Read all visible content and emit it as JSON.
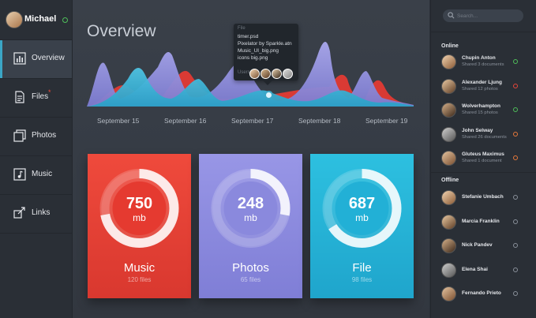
{
  "user": {
    "name": "Michael"
  },
  "nav": [
    {
      "label": "Overview",
      "icon": "bar-chart-icon",
      "badge": ""
    },
    {
      "label": "Files",
      "icon": "document-icon",
      "badge": "*"
    },
    {
      "label": "Photos",
      "icon": "photos-icon",
      "badge": ""
    },
    {
      "label": "Music",
      "icon": "music-icon",
      "badge": ""
    },
    {
      "label": "Links",
      "icon": "links-icon",
      "badge": ""
    }
  ],
  "page": {
    "title": "Overview"
  },
  "timeline": {
    "dates": [
      "September 15",
      "September 16",
      "September 17",
      "September 18",
      "September 19"
    ]
  },
  "tooltip": {
    "header": "File",
    "files": [
      "timer.psd",
      "Pixelator by Sparkle.atn",
      "Music_UI_big.png",
      "icons big.png"
    ],
    "users_label": "Users"
  },
  "cards": [
    {
      "value": "750",
      "unit": "mb",
      "name": "Music",
      "count": "120 files",
      "fill": 0.72,
      "color": "#e8463a"
    },
    {
      "value": "248",
      "unit": "mb",
      "name": "Photos",
      "count": "65 files",
      "fill": 0.28,
      "color": "#8e8ee0"
    },
    {
      "value": "687",
      "unit": "mb",
      "name": "File",
      "count": "98 files",
      "fill": 0.66,
      "color": "#26b4d6"
    }
  ],
  "search": {
    "placeholder": "Search..."
  },
  "online_label": "Online",
  "offline_label": "Offline",
  "online": [
    {
      "name": "Chupin Anton",
      "sub": "Shared 3 documents",
      "status": "#4fbf5a"
    },
    {
      "name": "Alexander Ljung",
      "sub": "Shared 12 photos",
      "status": "#e8463a"
    },
    {
      "name": "Wolverhampton",
      "sub": "Shared 15 photos",
      "status": "#4fbf5a"
    },
    {
      "name": "John Selway",
      "sub": "Shared 26 documents",
      "status": "#e8793a"
    },
    {
      "name": "Gluteus Maximus",
      "sub": "Shared 1 document",
      "status": "#e8793a"
    }
  ],
  "offline": [
    {
      "name": "Stefanie Umbach"
    },
    {
      "name": "Marcia Franklin"
    },
    {
      "name": "Nick Pandev"
    },
    {
      "name": "Elena Shai"
    },
    {
      "name": "Fernando Prieto"
    }
  ],
  "colors": {
    "accent": "#3ba6c6",
    "online": "#4fbf5a",
    "offline": "#8a919b"
  }
}
